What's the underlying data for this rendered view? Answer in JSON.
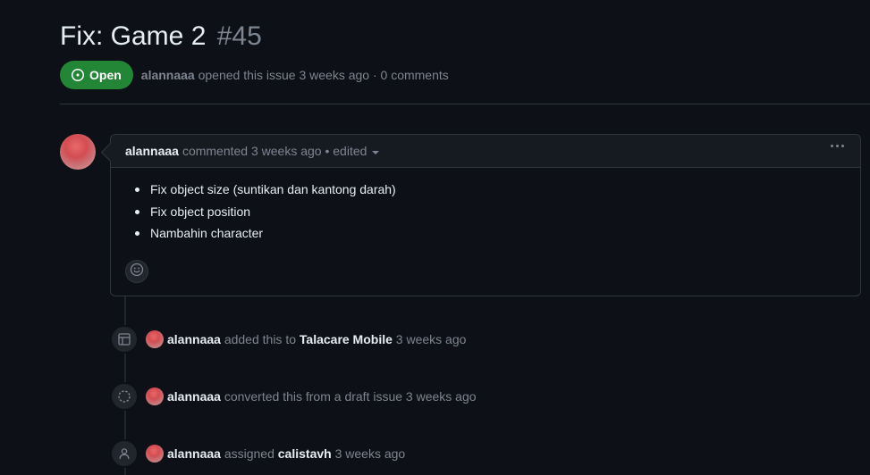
{
  "issue": {
    "title": "Fix: Game 2",
    "number": "#45",
    "state": "Open",
    "author": "alannaaa",
    "opened_text": "opened this issue 3 weeks ago · 0 comments"
  },
  "comment": {
    "author": "alannaaa",
    "meta": "commented 3 weeks ago • edited",
    "items": [
      "Fix object size (suntikan dan kantong darah)",
      "Fix object position",
      "Nambahin character"
    ]
  },
  "events": [
    {
      "icon": "project-table-icon",
      "author": "alannaaa",
      "action": "added this to",
      "target": "Talacare Mobile",
      "time": "3 weeks ago"
    },
    {
      "icon": "draft-circle-icon",
      "author": "alannaaa",
      "action": "converted this from a draft issue 3 weeks ago",
      "target": "",
      "time": ""
    },
    {
      "icon": "person-icon",
      "author": "alannaaa",
      "action": "assigned",
      "target": "calistavh",
      "time": "3 weeks ago"
    }
  ],
  "colors": {
    "background": "#0d1117",
    "open_badge": "#238636",
    "border": "#30363d",
    "muted_text": "#7d8590"
  }
}
